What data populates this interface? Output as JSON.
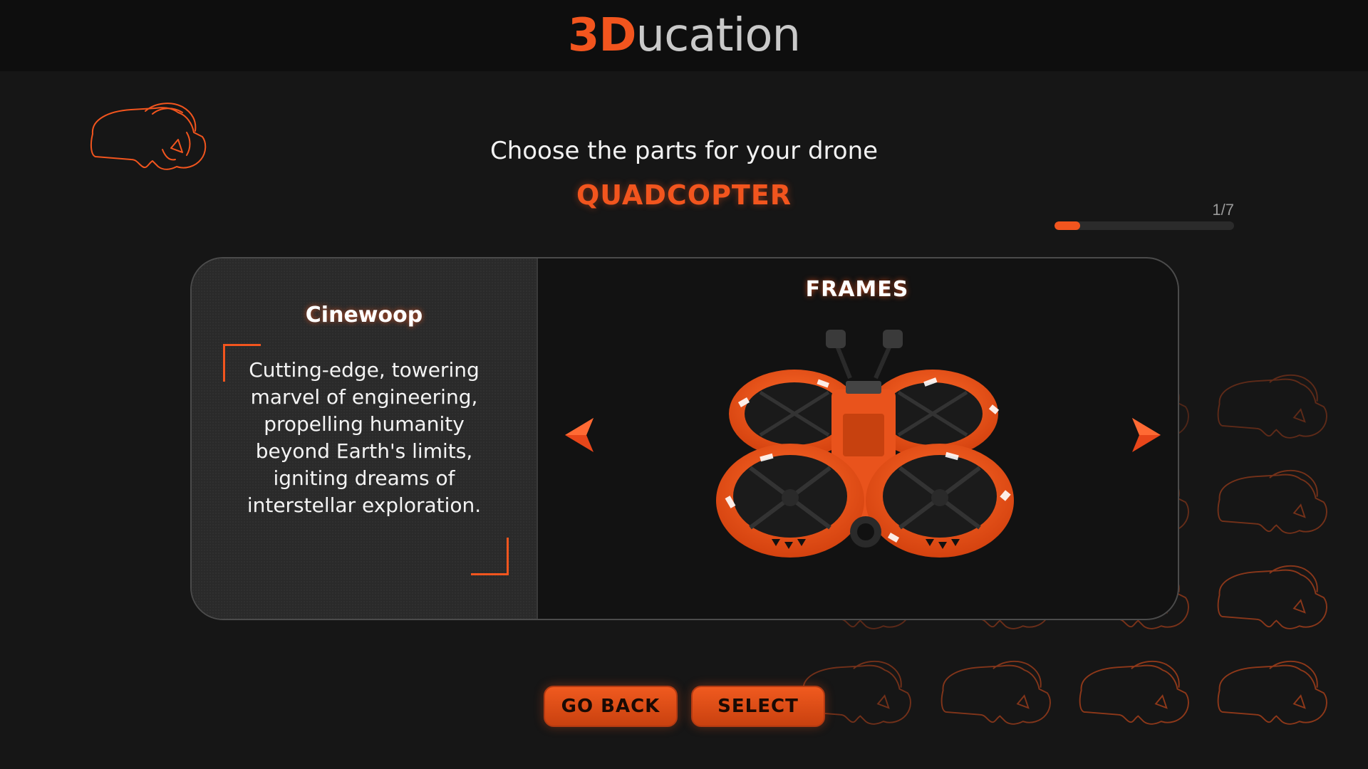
{
  "header": {
    "logo_brand": "3D",
    "logo_rest": "ucation"
  },
  "page": {
    "subtitle": "Choose the parts for your drone",
    "category": "QUADCOPTER"
  },
  "progress": {
    "label": "1/7",
    "current": 1,
    "total": 7
  },
  "card": {
    "item_title": "Cinewoop",
    "item_description": "Cutting-edge, towering marvel of engineering, propelling humanity beyond Earth's limits, igniting dreams of interstellar exploration.",
    "category_label": "FRAMES"
  },
  "buttons": {
    "back_label": "GO BACK",
    "select_label": "SELECT"
  },
  "icons": {
    "logo_icon": "vr-headset-icon",
    "prev_icon": "arrow-left-icon",
    "next_icon": "arrow-right-icon"
  },
  "colors": {
    "accent": "#f2551e",
    "background": "#161616",
    "topbar": "#0e0e0e",
    "panel": "#2a2a2a"
  }
}
